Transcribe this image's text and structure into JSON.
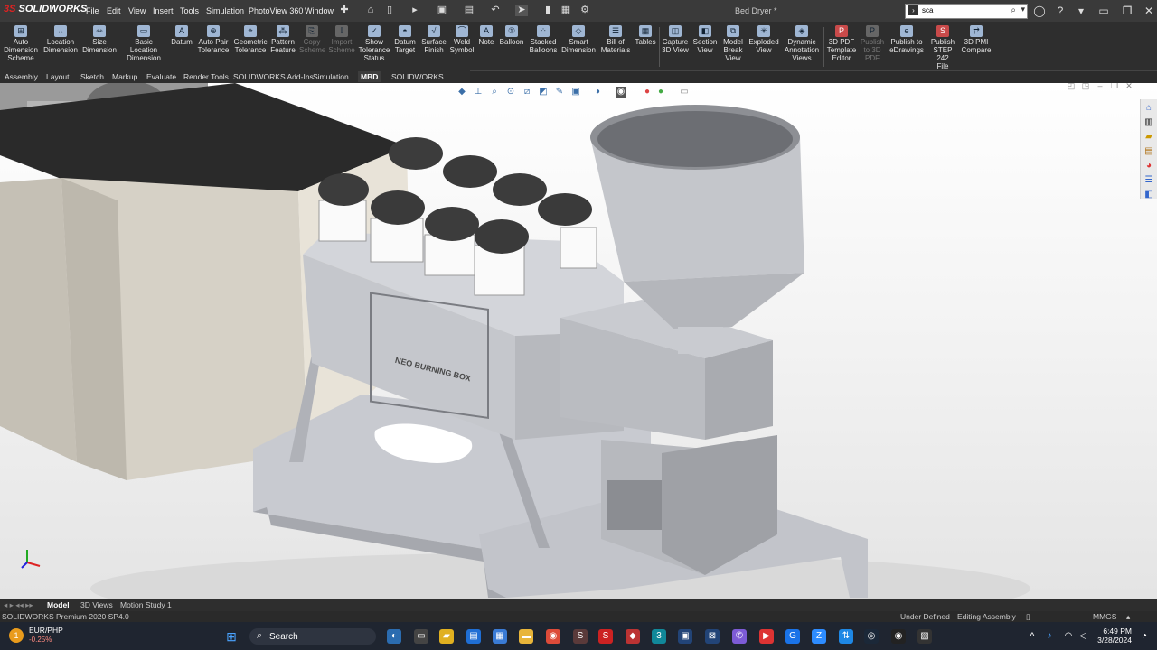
{
  "app": {
    "brand_prefix": "3S",
    "brand": "SOLIDWORKS",
    "doc_title": "Bed Dryer *"
  },
  "menu": [
    "File",
    "Edit",
    "View",
    "Insert",
    "Tools",
    "Simulation",
    "PhotoView 360",
    "Window"
  ],
  "search": {
    "value": "sca"
  },
  "ribbon": {
    "items": [
      {
        "label": "Auto\nDimension\nScheme",
        "icon": "auto-dimension-icon"
      },
      {
        "label": "Location\nDimension",
        "icon": "location-dimension-icon"
      },
      {
        "label": "Size\nDimension",
        "icon": "size-dimension-icon"
      },
      {
        "label": "Basic Location\nDimension",
        "icon": "basic-location-dimension-icon"
      },
      {
        "label": "Datum",
        "icon": "datum-icon"
      },
      {
        "label": "Auto Pair\nTolerance",
        "icon": "auto-pair-tolerance-icon"
      },
      {
        "label": "Geometric\nTolerance",
        "icon": "geometric-tolerance-icon"
      },
      {
        "label": "Pattern\nFeature",
        "icon": "pattern-feature-icon"
      },
      {
        "label": "Copy\nScheme",
        "icon": "copy-scheme-icon",
        "disabled": true
      },
      {
        "label": "Import\nScheme",
        "icon": "import-scheme-icon",
        "disabled": true
      },
      {
        "label": "Show\nTolerance\nStatus",
        "icon": "show-tolerance-status-icon"
      },
      {
        "label": "Datum\nTarget",
        "icon": "datum-target-icon"
      },
      {
        "label": "Surface\nFinish",
        "icon": "surface-finish-icon"
      },
      {
        "label": "Weld\nSymbol",
        "icon": "weld-symbol-icon"
      },
      {
        "label": "Note",
        "icon": "note-icon"
      },
      {
        "label": "Balloon",
        "icon": "balloon-icon"
      },
      {
        "label": "Stacked\nBalloons",
        "icon": "stacked-balloons-icon"
      },
      {
        "label": "Smart\nDimension",
        "icon": "smart-dimension-icon"
      },
      {
        "label": "Bill of\nMaterials",
        "icon": "bill-of-materials-icon"
      },
      {
        "label": "Tables",
        "icon": "tables-icon"
      },
      {
        "label": "Capture\n3D View",
        "icon": "capture-3d-view-icon"
      },
      {
        "label": "Section\nView",
        "icon": "section-view-icon"
      },
      {
        "label": "Model\nBreak\nView",
        "icon": "model-break-view-icon"
      },
      {
        "label": "Exploded\nView",
        "icon": "exploded-view-icon"
      },
      {
        "label": "Dynamic\nAnnotation\nViews",
        "icon": "dynamic-annotation-views-icon"
      },
      {
        "label": "3D PDF\nTemplate\nEditor",
        "icon": "3d-pdf-template-editor-icon"
      },
      {
        "label": "Publish\nto 3D\nPDF",
        "icon": "publish-3d-pdf-icon",
        "disabled": true
      },
      {
        "label": "Publish to\neDrawings",
        "icon": "publish-edrawings-icon"
      },
      {
        "label": "Publish\nSTEP 242\nFile",
        "icon": "publish-step-242-icon"
      },
      {
        "label": "3D PMI\nCompare",
        "icon": "3d-pmi-compare-icon"
      }
    ]
  },
  "tabs": [
    "Assembly",
    "Layout",
    "Sketch",
    "Markup",
    "Evaluate",
    "Render Tools",
    "SOLIDWORKS Add-Ins",
    "Simulation",
    "MBD",
    "SOLIDWORKS Visualize"
  ],
  "active_tab": "MBD",
  "model": {
    "engraving": "NEO BURNING BOX"
  },
  "model_tabs": [
    "Model",
    "3D Views",
    "Motion Study 1"
  ],
  "status": {
    "product": "SOLIDWORKS Premium 2020 SP4.0",
    "state": "Under Defined",
    "mode": "Editing Assembly",
    "units": "MMGS"
  },
  "taskbar": {
    "ticker_badge": "1",
    "ticker_pair": "EUR/PHP",
    "ticker_change": "-0.25%",
    "search_label": "Search",
    "time": "6:49 PM",
    "date": "3/28/2024"
  },
  "colors": {
    "accent": "#e6e6e6",
    "ribbon_bg": "#2e2e2e",
    "viewport_bg": "#f4f4f4",
    "metal": "#b9bcc4",
    "taskbar_bg": "#1f2530"
  }
}
